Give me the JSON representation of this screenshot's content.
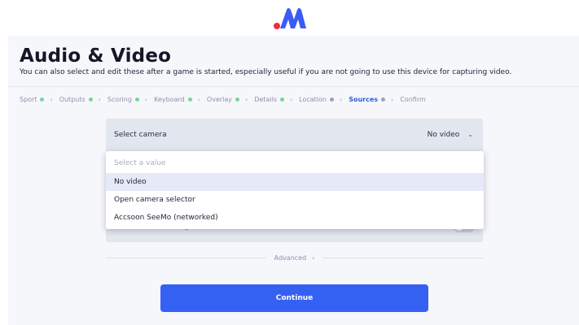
{
  "header": {
    "title": "Audio & Video",
    "subtitle": "You can also select and edit these after a game is started, especially useful if you are not going to use this device for capturing video."
  },
  "steps": [
    {
      "label": "Sport",
      "status": "complete"
    },
    {
      "label": "Outputs",
      "status": "complete"
    },
    {
      "label": "Scoring",
      "status": "complete"
    },
    {
      "label": "Keyboard",
      "status": "complete"
    },
    {
      "label": "Overlay",
      "status": "complete"
    },
    {
      "label": "Details",
      "status": "complete"
    },
    {
      "label": "Location",
      "status": "incomplete"
    },
    {
      "label": "Sources",
      "status": "active"
    },
    {
      "label": "Confirm",
      "status": "pending"
    }
  ],
  "camera": {
    "label": "Select camera",
    "value": "No video",
    "options": {
      "placeholder": "Select a value",
      "items": [
        "No video",
        "Open camera selector",
        "Accsoon SeeMo (networked)"
      ]
    }
  },
  "advanced": {
    "label": "Advanced"
  },
  "actions": {
    "continue_label": "Continue"
  },
  "colors": {
    "accent": "#3561f2",
    "complete": "#74d69b",
    "logo_red": "#ef2b43",
    "logo_blue": "#3b5cf4"
  },
  "icons": {
    "step_separator": "chevron-right-icon",
    "select": "chevron-down-icon"
  }
}
